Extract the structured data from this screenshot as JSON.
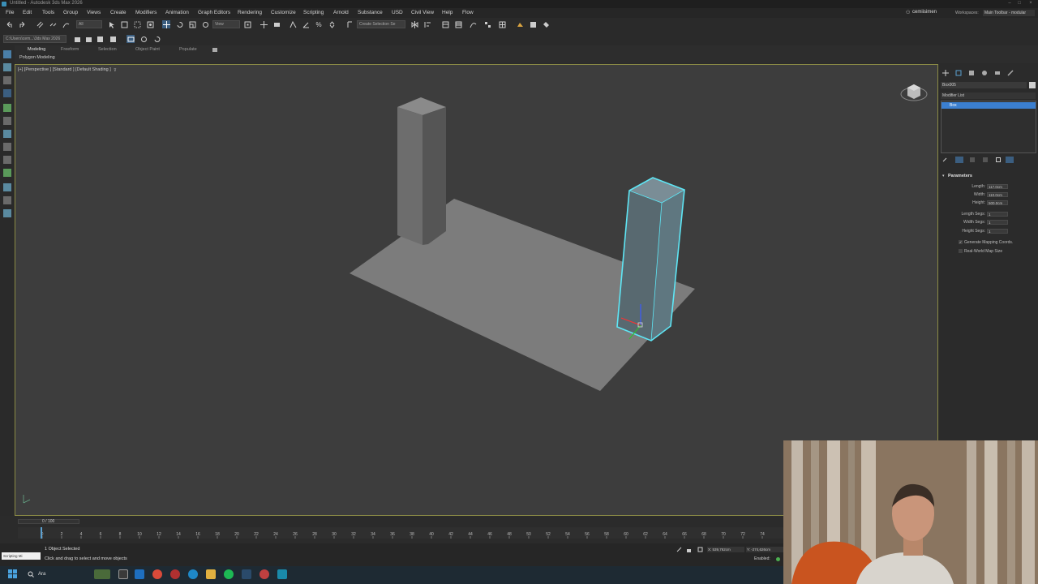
{
  "window": {
    "title": "Untitled - Autodesk 3ds Max 2026"
  },
  "menubar": {
    "items": [
      "File",
      "Edit",
      "Tools",
      "Group",
      "Views",
      "Create",
      "Modifiers",
      "Animation",
      "Graph Editors",
      "Rendering",
      "Customize",
      "Scripting",
      "Arnold",
      "Substance",
      "USD",
      "Civil View",
      "Help",
      "Flow"
    ],
    "user": "cemiisimen",
    "workspaces_label": "Workspaces:",
    "workspace_value": "Main Toolbar - modular"
  },
  "toolbar": {
    "selection_filter": "All",
    "ref_coord": "View",
    "create_selection_set": "Create Selection Se",
    "project_path": "C:\\Users\\cem...\\3ds Max 2026"
  },
  "ribbon": {
    "tabs": [
      "Modeling",
      "Freeform",
      "Selection",
      "Object Paint",
      "Populate"
    ],
    "active_tab": "Modeling",
    "subtitle": "Polygon Modeling"
  },
  "viewport": {
    "label": "[+] [Perspective ] [Standard ] [Default Shading ]",
    "colors": {
      "selection": "#5ee6f5",
      "border": "#8a8a45"
    }
  },
  "command_panel": {
    "object_name": "Box005",
    "modifier_list_label": "Modifier List",
    "stack_item": "Box",
    "rollout_title": "Parameters",
    "params": [
      {
        "label": "Length:",
        "value": "117,0cm"
      },
      {
        "label": "Width:",
        "value": "110,0cm"
      },
      {
        "label": "Height:",
        "value": "500,0cm"
      },
      {
        "label": "Length Segs:",
        "value": "1"
      },
      {
        "label": "Width Segs:",
        "value": "1"
      },
      {
        "label": "Height Segs:",
        "value": "1"
      }
    ],
    "check_generate": "Generate Mapping Coords.",
    "check_realworld": "Real-World Map Size"
  },
  "timeline": {
    "frame_display": "0 / 100",
    "ticks": [
      "0",
      "2",
      "4",
      "6",
      "8",
      "10",
      "12",
      "14",
      "16",
      "18",
      "20",
      "22",
      "24",
      "26",
      "28",
      "30",
      "32",
      "34",
      "36",
      "38",
      "40",
      "42",
      "44",
      "46",
      "48",
      "50",
      "52",
      "54",
      "56",
      "58",
      "60",
      "62",
      "64",
      "66",
      "68",
      "70",
      "72",
      "74",
      "76"
    ]
  },
  "statusbar": {
    "maxscript_label": "Scripting Mi",
    "selected": "1 Object Selected",
    "prompt": "Click and drag to select and move objects",
    "coord_x": "X: 539,762cm",
    "coord_y": "Y: -274,626cm",
    "enabled_label": "Enabled:"
  },
  "taskbar": {
    "search_label": "Ara"
  }
}
